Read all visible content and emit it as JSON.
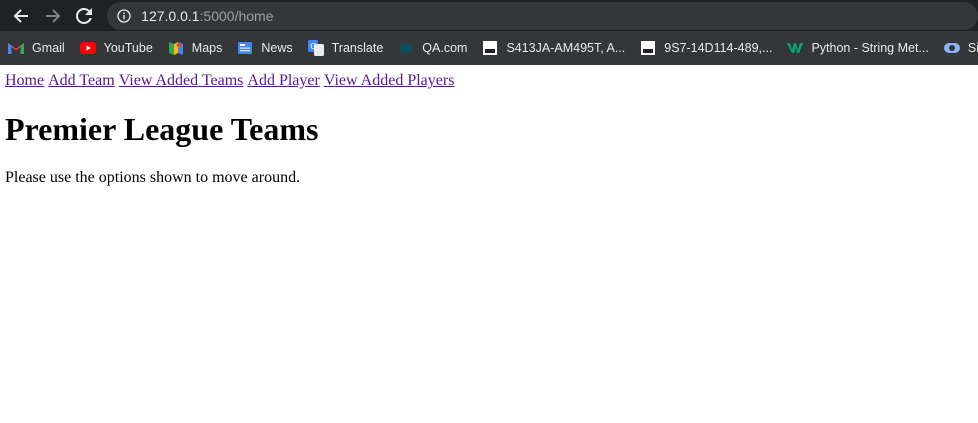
{
  "browser": {
    "url_host": "127.0.0.1",
    "url_rest": ":5000/home",
    "bookmarks": [
      {
        "label": "Gmail",
        "icon": "gmail-icon"
      },
      {
        "label": "YouTube",
        "icon": "youtube-icon"
      },
      {
        "label": "Maps",
        "icon": "maps-icon"
      },
      {
        "label": "News",
        "icon": "news-icon"
      },
      {
        "label": "Translate",
        "icon": "translate-icon"
      },
      {
        "label": "QA.com",
        "icon": "qa-icon"
      },
      {
        "label": "S413JA-AM495T, A...",
        "icon": "box-icon"
      },
      {
        "label": "9S7-14D114-489,...",
        "icon": "box-icon"
      },
      {
        "label": "Python - String Met...",
        "icon": "w3-icon"
      },
      {
        "label": "Sign in",
        "icon": "signin-icon"
      }
    ],
    "colors": {
      "toolbar": "#202124",
      "bookmarks_bar": "#35363a",
      "link_visited": "#551a8b"
    }
  },
  "page": {
    "nav": {
      "home": "Home",
      "add_team": "Add Team",
      "view_teams": "View Added Teams",
      "add_player": "Add Player",
      "view_players": "View Added Players"
    },
    "title": "Premier League Teams",
    "intro": "Please use the options shown to move around."
  }
}
